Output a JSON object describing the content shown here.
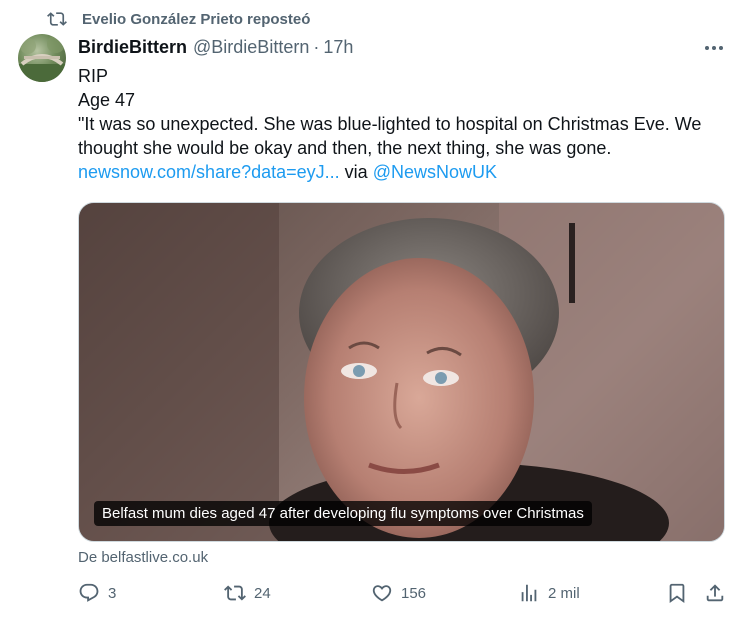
{
  "repost": {
    "text": "Evelio González Prieto reposteó",
    "icon": "repost-icon"
  },
  "tweet": {
    "display_name": "BirdieBittern",
    "handle": "@BirdieBittern",
    "separator": "·",
    "time": "17h",
    "lines": [
      "RIP",
      "Age 47",
      "\"It was so unexpected. She was blue-lighted to hospital on Christmas Eve. We",
      "thought she would be okay and then, the next thing, she was gone."
    ],
    "link_text": "newsnow.com/share?data=eyJ...",
    "via_text": "via",
    "mention": "@NewsNowUK",
    "card": {
      "caption": "Belfast mum dies aged 47 after developing flu symptoms over Christmas",
      "source": "De belfastlive.co.uk"
    },
    "actions": {
      "replies": "3",
      "reposts": "24",
      "likes": "156",
      "views": "2 mil"
    }
  },
  "colors": {
    "link": "#1d9bf0",
    "muted": "#536471",
    "text": "#0f1419"
  }
}
